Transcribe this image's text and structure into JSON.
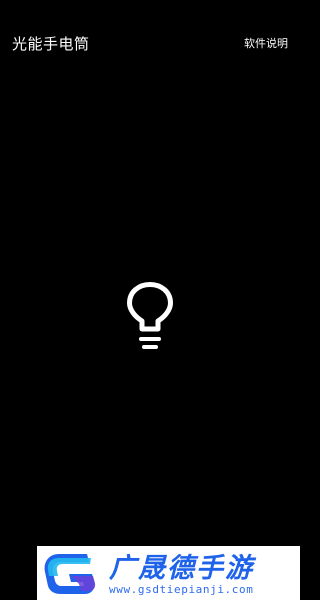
{
  "app": {
    "title": "光能手电筒",
    "help_label": "软件说明"
  },
  "flashlight": {
    "icon": "lightbulb-icon",
    "state": "off"
  },
  "watermark": {
    "name": "广晟德手游",
    "url": "www.gsdtiepianji.com",
    "logo_icon": "brand-logo-icon",
    "colors": {
      "primary": "#1e63e9",
      "accent": "#22b8f0",
      "secondary": "#6a3fd9"
    }
  },
  "theme": {
    "background": "#000000",
    "foreground": "#ffffff"
  }
}
